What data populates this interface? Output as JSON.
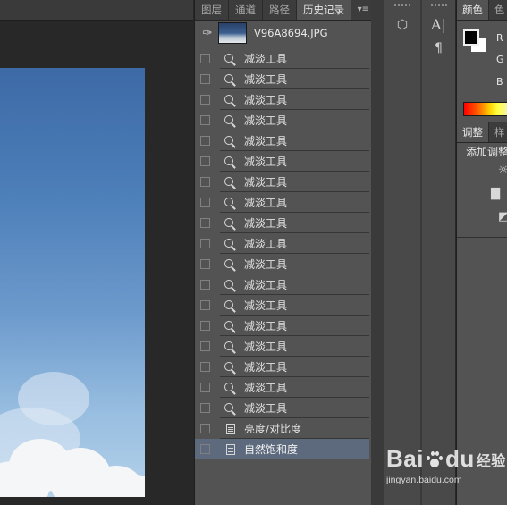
{
  "history_panel": {
    "tabs": [
      "图层",
      "通道",
      "路径",
      "历史记录"
    ],
    "active_tab": "历史记录",
    "menu_glyph": "▾≡",
    "snapshot": {
      "label": "V96A8694.JPG"
    },
    "items": [
      {
        "label": "减淡工具",
        "icon": "dodge-tool-icon"
      },
      {
        "label": "减淡工具",
        "icon": "dodge-tool-icon"
      },
      {
        "label": "减淡工具",
        "icon": "dodge-tool-icon"
      },
      {
        "label": "减淡工具",
        "icon": "dodge-tool-icon"
      },
      {
        "label": "减淡工具",
        "icon": "dodge-tool-icon"
      },
      {
        "label": "减淡工具",
        "icon": "dodge-tool-icon"
      },
      {
        "label": "减淡工具",
        "icon": "dodge-tool-icon"
      },
      {
        "label": "减淡工具",
        "icon": "dodge-tool-icon"
      },
      {
        "label": "减淡工具",
        "icon": "dodge-tool-icon"
      },
      {
        "label": "减淡工具",
        "icon": "dodge-tool-icon"
      },
      {
        "label": "减淡工具",
        "icon": "dodge-tool-icon"
      },
      {
        "label": "减淡工具",
        "icon": "dodge-tool-icon"
      },
      {
        "label": "减淡工具",
        "icon": "dodge-tool-icon"
      },
      {
        "label": "减淡工具",
        "icon": "dodge-tool-icon"
      },
      {
        "label": "减淡工具",
        "icon": "dodge-tool-icon"
      },
      {
        "label": "减淡工具",
        "icon": "dodge-tool-icon"
      },
      {
        "label": "减淡工具",
        "icon": "dodge-tool-icon"
      },
      {
        "label": "减淡工具",
        "icon": "dodge-tool-icon"
      },
      {
        "label": "亮度/对比度",
        "icon": "adjustment-layer-icon"
      },
      {
        "label": "自然饱和度",
        "icon": "adjustment-layer-icon",
        "active": true
      }
    ]
  },
  "dock": {
    "text_tool_glyph": "A|",
    "paragraph_glyph": "¶"
  },
  "color_panel": {
    "tabs": [
      "颜色",
      "色"
    ],
    "channels": [
      "R",
      "G",
      "B"
    ],
    "foreground_color": "#000000",
    "background_color": "#ffffff"
  },
  "adjustments_panel": {
    "tabs": [
      "调整",
      "样"
    ],
    "title": "添加调整"
  },
  "watermark": {
    "brand_left": "Bai",
    "brand_right": "du",
    "brand_cn": "经验",
    "url": "jingyan.baidu.com"
  }
}
